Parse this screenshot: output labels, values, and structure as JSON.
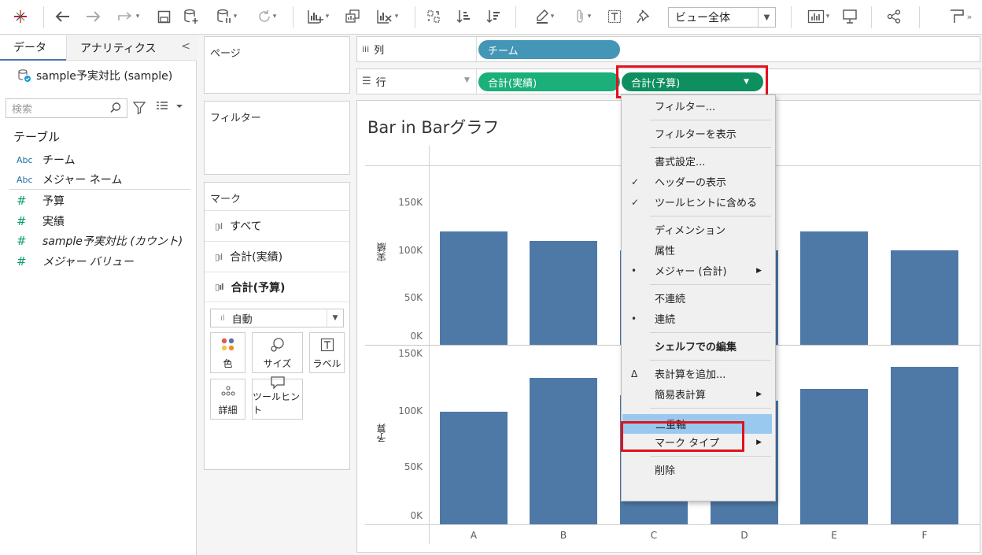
{
  "toolbar": {
    "view_select_value": "ビュー全体",
    "icons": [
      "tableau-logo-icon",
      "undo-icon",
      "redo-icon",
      "replay-icon",
      "save-icon",
      "new-datasource-icon",
      "pause-update-icon",
      "refresh-icon",
      "new-worksheet-icon",
      "duplicate-icon",
      "clear-icon",
      "swap-icon",
      "sort-ascending-icon",
      "sort-descending-icon",
      "highlight-icon",
      "group-icon",
      "label-icon",
      "pin-icon",
      "show-me-icon",
      "presentation-icon",
      "share-icon",
      "tooltip-icon"
    ]
  },
  "left_pane": {
    "tab_data": "データ",
    "tab_analytics": "アナリティクス",
    "collapse": "<",
    "datasource": "sample予実対比 (sample)",
    "search_placeholder": "検索",
    "tables_heading": "テーブル",
    "dimensions": [
      {
        "icon": "Abc",
        "label": "チーム"
      },
      {
        "icon": "Abc",
        "label": "メジャー ネーム"
      }
    ],
    "measures": [
      {
        "icon": "#",
        "label": "予算"
      },
      {
        "icon": "#",
        "label": "実績"
      },
      {
        "icon": "#",
        "label": "sample予実対比 (カウント)"
      },
      {
        "icon": "#",
        "label": "メジャー バリュー"
      }
    ]
  },
  "cards": {
    "pages_title": "ページ",
    "filters_title": "フィルター",
    "marks_title": "マーク",
    "mark_rows": [
      "すべて",
      "合計(実績)",
      "合計(予算)"
    ],
    "mark_type": "自動",
    "mark_buttons": [
      "色",
      "サイズ",
      "ラベル",
      "詳細",
      "ツールヒント"
    ]
  },
  "shelves": {
    "columns_label": "列",
    "rows_label": "行",
    "columns_pills": [
      "チーム"
    ],
    "rows_pills": [
      "合計(実績)",
      "合計(予算)"
    ],
    "pill_colors": {
      "dimension": "#4496b6",
      "measure": "#1baf7a",
      "measure_active": "#0e8f5f"
    }
  },
  "chart_data": {
    "type": "bar",
    "title": "Bar in Barグラフ",
    "categories": [
      "A",
      "B",
      "C",
      "D",
      "E",
      "F"
    ],
    "panes": [
      {
        "ylabel": "実績",
        "ticks": [
          "0K",
          "50K",
          "100K",
          "150K"
        ],
        "ylim": [
          0,
          180000
        ],
        "values": [
          120000,
          110000,
          100000,
          100000,
          120000,
          100000
        ],
        "color": "#4e79a7"
      },
      {
        "ylabel": "予算",
        "ticks": [
          "0K",
          "50K",
          "100K",
          "150K"
        ],
        "ylim": [
          0,
          150000
        ],
        "values": [
          100000,
          130000,
          115000,
          110000,
          120000,
          140000
        ],
        "color": "#4e79a7"
      }
    ]
  },
  "context_menu": {
    "items": [
      {
        "label": "フィルター...",
        "mark": ""
      },
      {
        "sep": true
      },
      {
        "label": "フィルターを表示",
        "mark": ""
      },
      {
        "sep": true
      },
      {
        "label": "書式設定...",
        "mark": ""
      },
      {
        "label": "ヘッダーの表示",
        "mark": "✓"
      },
      {
        "label": "ツールヒントに含める",
        "mark": "✓"
      },
      {
        "sep": true
      },
      {
        "label": "ディメンション",
        "mark": ""
      },
      {
        "label": "属性",
        "mark": ""
      },
      {
        "label": "メジャー (合計)",
        "mark": "•",
        "submenu": true
      },
      {
        "sep": true
      },
      {
        "label": "不連続",
        "mark": ""
      },
      {
        "label": "連続",
        "mark": "•"
      },
      {
        "sep": true
      },
      {
        "label": "シェルフでの編集",
        "mark": "",
        "bold": true
      },
      {
        "sep": true
      },
      {
        "label": "表計算を追加...",
        "mark": "Δ"
      },
      {
        "label": "簡易表計算",
        "mark": "",
        "submenu": true
      },
      {
        "sep": true
      },
      {
        "label": "二重軸",
        "mark": "",
        "highlighted": true
      },
      {
        "label": "マーク タイプ",
        "mark": "",
        "submenu": true
      },
      {
        "sep": true
      },
      {
        "label": "削除",
        "mark": ""
      }
    ]
  }
}
